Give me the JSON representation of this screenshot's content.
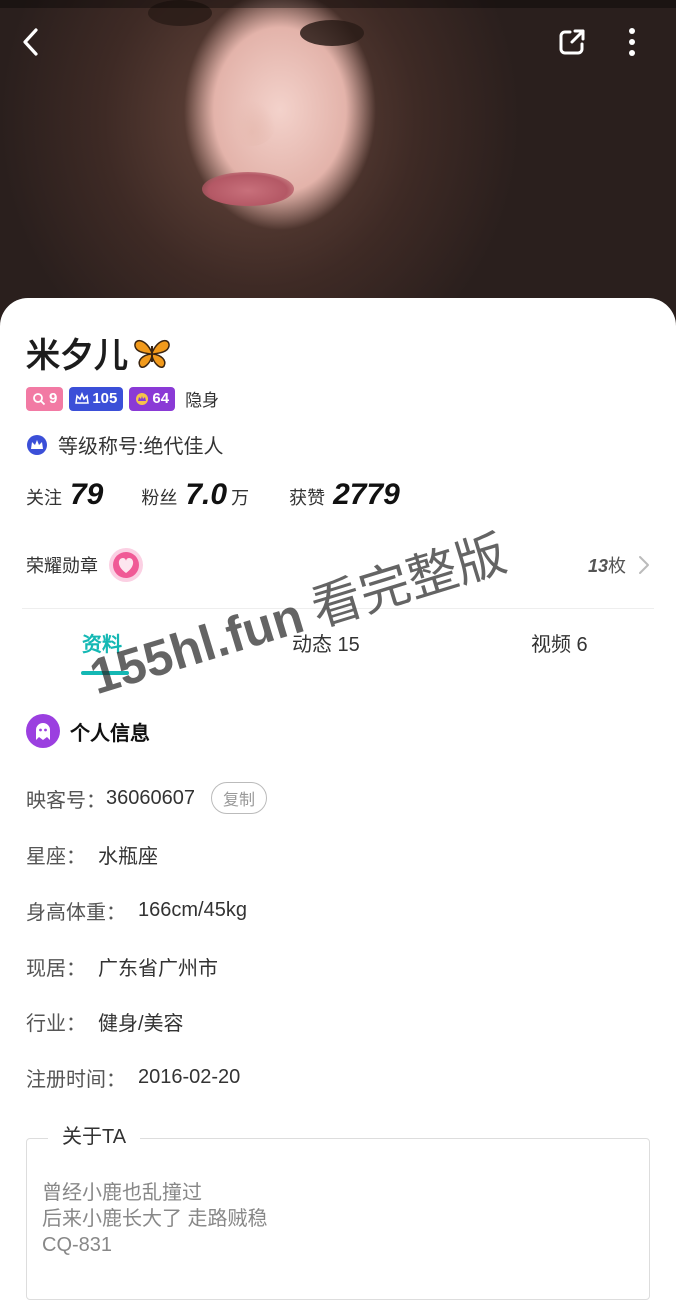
{
  "profile": {
    "name": "米夕儿",
    "badges": [
      {
        "value": "9",
        "color": "#f27aa4",
        "icon": "search-heart-icon"
      },
      {
        "value": "105",
        "color": "#3b4fd8",
        "icon": "crown-icon"
      },
      {
        "value": "64",
        "color": "#8a3ad6",
        "icon": "crown-level-icon"
      }
    ],
    "hidden_tag": "隐身",
    "level_title": "等级称号:绝代佳人",
    "stats": {
      "follow_label": "关注",
      "follow_value": "79",
      "fans_label": "粉丝",
      "fans_value": "7.0",
      "fans_unit": "万",
      "likes_label": "获赞",
      "likes_value": "2779"
    },
    "honor": {
      "label": "荣耀勋章",
      "count_num": "13",
      "count_unit": "枚"
    }
  },
  "tabs": [
    {
      "label": "资料",
      "active": true
    },
    {
      "label": "动态 15",
      "active": false
    },
    {
      "label": "视频 6",
      "active": false
    }
  ],
  "info": {
    "section_title": "个人信息",
    "id_label": "映客号：",
    "id_value": "36060607",
    "copy_label": "复制",
    "constellation_label": "星座：",
    "constellation_value": "水瓶座",
    "height_weight_label": "身高体重：",
    "height_weight_value": "166cm/45kg",
    "residence_label": "现居：",
    "residence_value": "广东省广州市",
    "industry_label": "行业：",
    "industry_value": "健身/美容",
    "register_label": "注册时间：",
    "register_value": "2016-02-20"
  },
  "about": {
    "title": "关于TA",
    "lines": [
      "曾经小鹿也乱撞过",
      "后来小鹿长大了 走路贼稳",
      "CQ-831"
    ]
  },
  "watermark": {
    "domain": "155hl.fun",
    "text": "看完整版"
  },
  "colors": {
    "accent": "#14b8b4",
    "section_icon": "#9b3fe0"
  }
}
